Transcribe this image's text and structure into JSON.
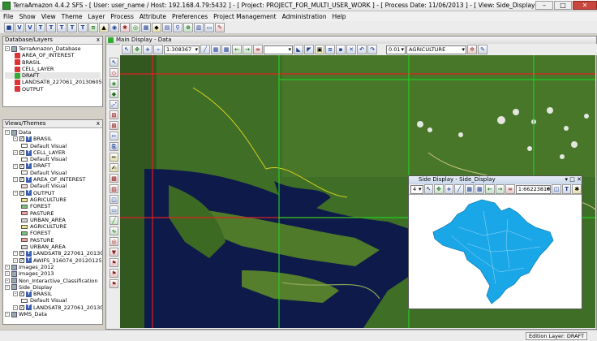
{
  "window": {
    "title": "TerraAmazon 4.4.2 SFS  - [ User: user_name / Host: 192.168.4.79:5432 ] - [ Project: PROJECT_FOR_MULTI_USER_WORK ] - [ Process Date: 11/06/2013 ] - [ View: Side_Display ]",
    "min": "–",
    "max": "□",
    "close": "✕"
  },
  "menu": [
    "File",
    "Show",
    "View",
    "Theme",
    "Layer",
    "Process",
    "Attribute",
    "Preferences",
    "Project Management",
    "Administration",
    "Help"
  ],
  "toolbar_icons": [
    "box-icon",
    "v-icon",
    "v-icon",
    "t-icon",
    "t-icon",
    "t-icon",
    "t-icon",
    "t-icon",
    "layers-icon",
    "lock-icon",
    "db-icon",
    "gear-icon",
    "globe-icon",
    "grid-icon",
    "palette-icon",
    "layout-icon",
    "search-icon",
    "zoom-icon",
    "chart-icon",
    "print-icon",
    "brush-icon"
  ],
  "db_panel": {
    "title": "Database/Layers",
    "close": "x",
    "items": [
      {
        "label": "TerraAmazon_Database",
        "level": 0,
        "icon": "db"
      },
      {
        "label": "AREA_OF_INTEREST",
        "level": 1,
        "icon": "layer"
      },
      {
        "label": "BRASIL",
        "level": 1,
        "icon": "layer"
      },
      {
        "label": "CELL_LAYER",
        "level": 1,
        "icon": "layer"
      },
      {
        "label": "DRAFT",
        "level": 1,
        "icon": "layer-g"
      },
      {
        "label": "LANDSAT8_227061_20130605",
        "level": 1,
        "icon": "layer"
      },
      {
        "label": "OUTPUT",
        "level": 1,
        "icon": "layer"
      }
    ]
  },
  "views_panel": {
    "title": "Views/Themes",
    "close": "x",
    "items": [
      {
        "label": "Data",
        "level": 0,
        "type": "view"
      },
      {
        "label": "BRASIL",
        "level": 1,
        "type": "theme",
        "checked": true
      },
      {
        "label": "Default Visual",
        "level": 2,
        "type": "visual",
        "color": "#ffffff"
      },
      {
        "label": "CELL_LAYER",
        "level": 1,
        "type": "theme",
        "checked": true
      },
      {
        "label": "Default Visual",
        "level": 2,
        "type": "visual",
        "color": "#ffffff"
      },
      {
        "label": "DRAFT",
        "level": 1,
        "type": "theme",
        "checked": true
      },
      {
        "label": "Default Visual",
        "level": 2,
        "type": "visual",
        "color": "#ffffff"
      },
      {
        "label": "AREA_OF_INTEREST",
        "level": 1,
        "type": "theme",
        "checked": true
      },
      {
        "label": "Default Visual",
        "level": 2,
        "type": "visual",
        "color": "#f5d9d9"
      },
      {
        "label": "OUTPUT",
        "level": 1,
        "type": "theme",
        "checked": true
      },
      {
        "label": "AGRICULTURE",
        "level": 2,
        "type": "visual",
        "color": "#f0e68c"
      },
      {
        "label": "FOREST",
        "level": 2,
        "type": "visual",
        "color": "#7fbf7f"
      },
      {
        "label": "PASTURE",
        "level": 2,
        "type": "visual",
        "color": "#f4a0a0"
      },
      {
        "label": "URBAN_AREA",
        "level": 2,
        "type": "visual",
        "color": "#d8d8d8"
      },
      {
        "label": "AGRICULTURE",
        "level": 2,
        "type": "visual",
        "color": "#f0e68c"
      },
      {
        "label": "FOREST",
        "level": 2,
        "type": "visual",
        "color": "#7fbf7f"
      },
      {
        "label": "PASTURE",
        "level": 2,
        "type": "visual",
        "color": "#f4a0a0"
      },
      {
        "label": "URBAN_AREA",
        "level": 2,
        "type": "visual",
        "color": "#d8d8d8"
      },
      {
        "label": "LANDSAT8_227061_20130605",
        "level": 1,
        "type": "theme",
        "checked": true
      },
      {
        "label": "AWIFS_316074_20120125",
        "level": 1,
        "type": "theme",
        "checked": true
      },
      {
        "label": "Images_2012",
        "level": 0,
        "type": "view"
      },
      {
        "label": "Images_2013",
        "level": 0,
        "type": "view"
      },
      {
        "label": "Non_Interactive_Classification",
        "level": 0,
        "type": "view"
      },
      {
        "label": "Side_Display",
        "level": 0,
        "type": "view"
      },
      {
        "label": "BRASIL",
        "level": 1,
        "type": "theme",
        "checked": true
      },
      {
        "label": "Default Visual",
        "level": 2,
        "type": "visual",
        "color": "#ffffff"
      },
      {
        "label": "LANDSAT8_227061_20130605",
        "level": 1,
        "type": "theme",
        "checked": true
      },
      {
        "label": "WMS_Data",
        "level": 0,
        "type": "view"
      }
    ]
  },
  "main_display": {
    "title": "Main Display - Data",
    "scale": "1:308367",
    "line_width": "0.01",
    "class": "AGRICULTURE"
  },
  "side_display": {
    "title": "Side Display - Side_Display",
    "zoom": "4",
    "scale": "1:66223810"
  },
  "status": {
    "edition_layer": "Edition Layer: DRAFT"
  },
  "colors": {
    "water": "#0d1a4a",
    "vegetation": "#4f8a2a",
    "grid_red": "#e02020",
    "grid_green": "#22cc22",
    "brazil": "#1aa7e8"
  }
}
